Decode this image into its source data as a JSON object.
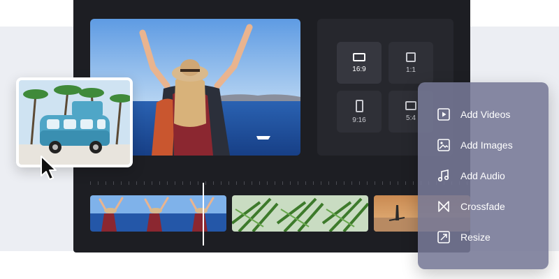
{
  "aspect_ratios": [
    {
      "label": "16:9",
      "active": true
    },
    {
      "label": "1:1",
      "active": false
    },
    {
      "label": "9:16",
      "active": false
    },
    {
      "label": "5:4",
      "active": false
    }
  ],
  "menu": {
    "items": [
      {
        "label": "Add Videos",
        "icon": "video-file-icon"
      },
      {
        "label": "Add Images",
        "icon": "image-file-icon"
      },
      {
        "label": "Add Audio",
        "icon": "music-note-icon"
      },
      {
        "label": "Crossfade",
        "icon": "crossfade-icon"
      },
      {
        "label": "Resize",
        "icon": "resize-icon"
      }
    ]
  },
  "colors": {
    "editor_bg": "#1d1e23",
    "panel_bg": "#26272d",
    "menu_bg": "#767996",
    "sky": "#6fa9e8",
    "sea": "#1f4f9c"
  }
}
